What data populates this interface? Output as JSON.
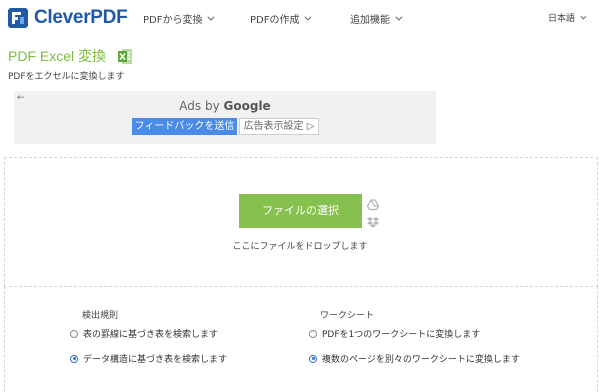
{
  "header": {
    "logo_text": "CleverPDF",
    "nav": [
      {
        "label": "PDFから変換"
      },
      {
        "label": "PDFの作成"
      },
      {
        "label": "追加機能"
      }
    ],
    "language": "日本語"
  },
  "page": {
    "title": "PDF Excel 変換",
    "subtitle": "PDFをエクセルに変換します"
  },
  "ad": {
    "back_arrow": "←",
    "ads_by": "Ads by",
    "google": "Google",
    "feedback_button": "フィードバックを送信",
    "settings_button": "広告表示設定 ▷"
  },
  "upload": {
    "choose_button": "ファイルの選択",
    "drop_hint": "ここにファイルをドロップします"
  },
  "options": {
    "detection": {
      "heading": "検出規則",
      "choices": [
        {
          "label": "表の罫線に基づき表を検索します",
          "selected": false
        },
        {
          "label": "データ構造に基づき表を検索します",
          "selected": true
        }
      ]
    },
    "worksheet": {
      "heading": "ワークシート",
      "choices": [
        {
          "label": "PDFを1つのワークシートに変換します",
          "selected": false
        },
        {
          "label": "複数のページを別々のワークシートに変換します",
          "selected": true
        }
      ]
    }
  },
  "colors": {
    "brand_blue": "#1f5aa6",
    "accent_green": "#7bbd3c",
    "button_green": "#86c04f",
    "ad_button_blue": "#4a8ae8"
  }
}
